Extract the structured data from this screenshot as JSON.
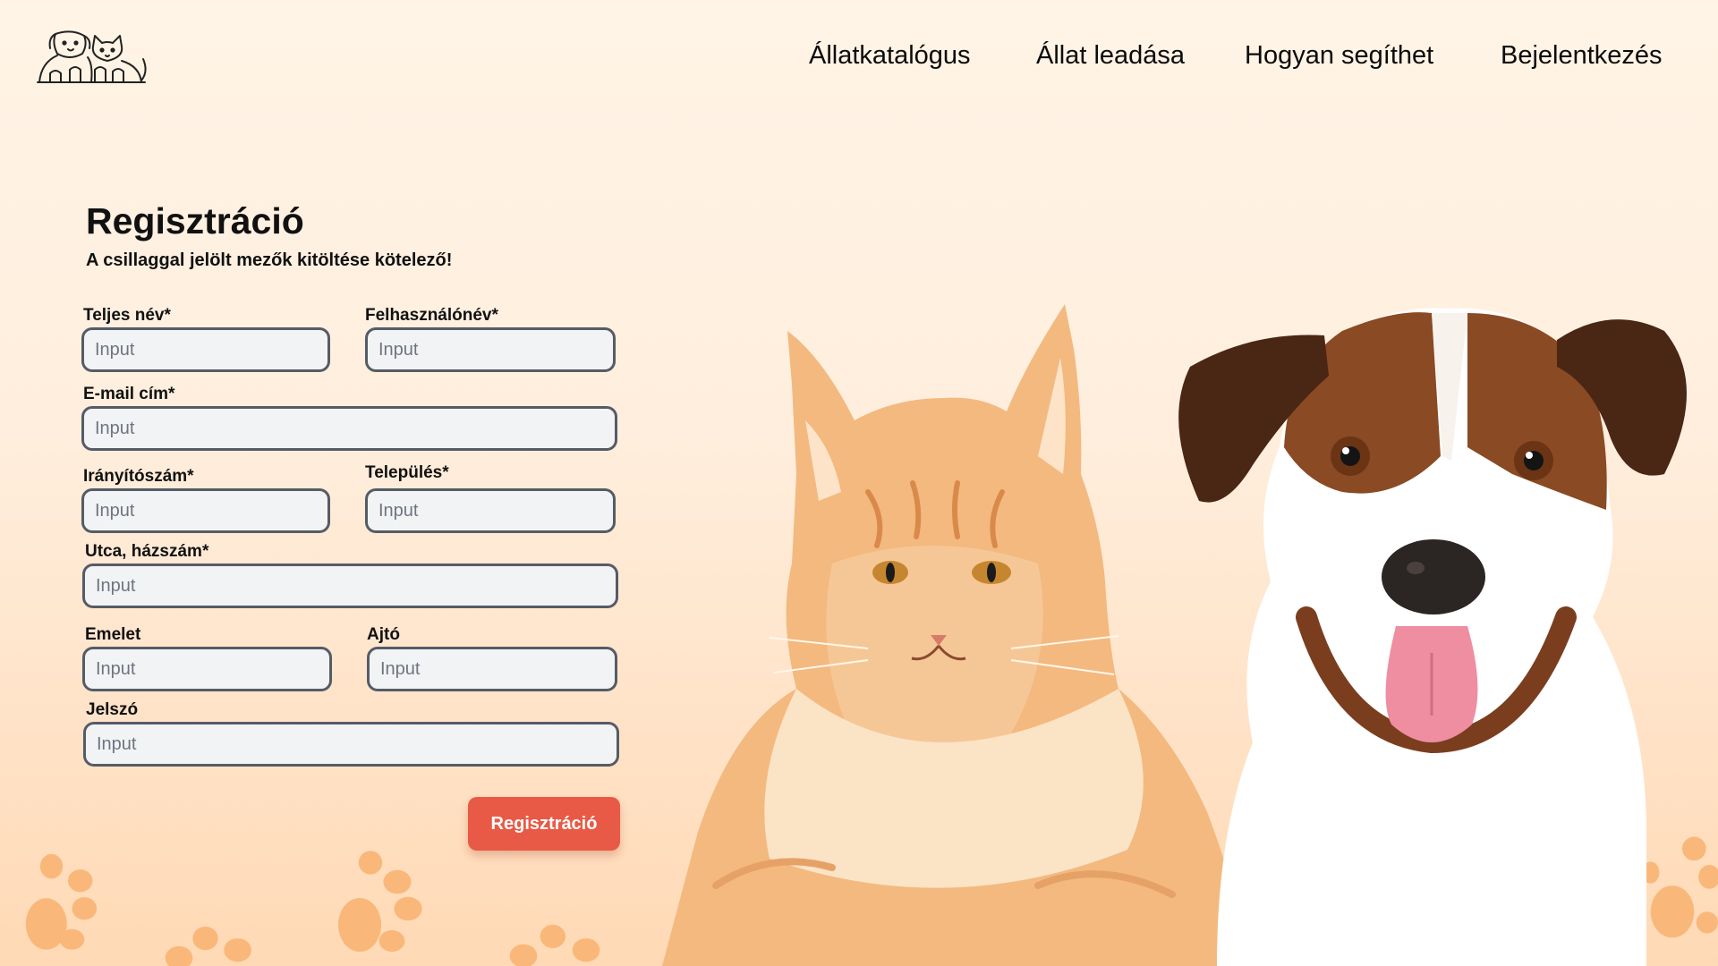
{
  "nav": {
    "items": [
      "Állatkatalógus",
      "Állat leadása",
      "Hogyan segíthet",
      "Bejelentkezés"
    ]
  },
  "form": {
    "title": "Regisztráció",
    "subtitle": "A csillaggal jelölt mezők kitöltése kötelező!",
    "fields": {
      "full_name": {
        "label": "Teljes név*",
        "placeholder": "Input",
        "value": ""
      },
      "username": {
        "label": "Felhasználónév*",
        "placeholder": "Input",
        "value": ""
      },
      "email": {
        "label": "E-mail cím*",
        "placeholder": "Input",
        "value": ""
      },
      "postal_code": {
        "label": "Irányítószám*",
        "placeholder": "Input",
        "value": ""
      },
      "city": {
        "label": "Település*",
        "placeholder": "Input",
        "value": ""
      },
      "street": {
        "label": "Utca, házszám*",
        "placeholder": "Input",
        "value": ""
      },
      "floor": {
        "label": "Emelet",
        "placeholder": "Input",
        "value": ""
      },
      "door": {
        "label": "Ajtó",
        "placeholder": "Input",
        "value": ""
      },
      "password": {
        "label": "Jelszó",
        "placeholder": "Input",
        "value": ""
      }
    },
    "submit_label": "Regisztráció"
  },
  "colors": {
    "accent": "#e85a45",
    "background_top": "#fff4e6",
    "background_bottom": "#ffd9b5",
    "paw": "#f9b87a",
    "input_bg": "#f2f3f5",
    "input_border": "#555c66"
  },
  "icons": {
    "logo": "dog-and-cat-logo-icon",
    "paw": "paw-print-icon"
  },
  "hero": {
    "image": "cat-and-dog-photo"
  }
}
